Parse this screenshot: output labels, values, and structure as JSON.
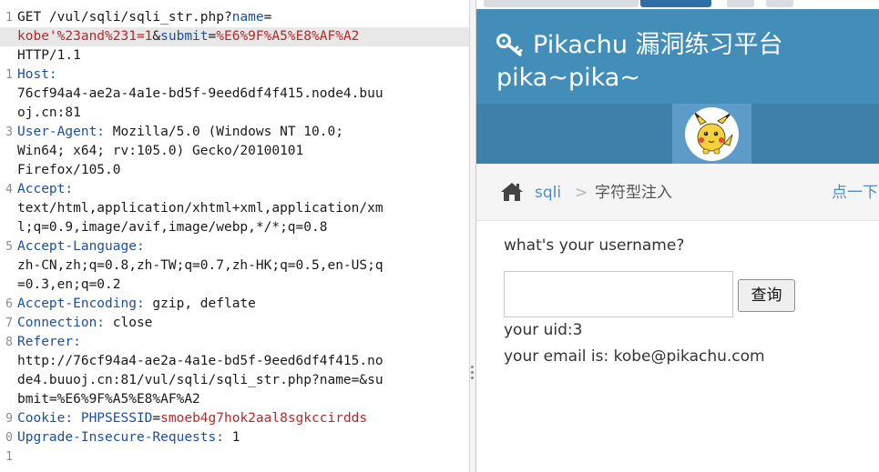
{
  "request_editor": {
    "lines": [
      {
        "num": "1",
        "highlight": false,
        "segments": [
          {
            "t": "GET /vul/sqli/sqli_str.php?",
            "c": ""
          },
          {
            "t": "name",
            "c": "pn"
          },
          {
            "t": "=",
            "c": ""
          }
        ]
      },
      {
        "num": "",
        "highlight": true,
        "segments": [
          {
            "t": "kobe'%23and%231=1",
            "c": "pv"
          },
          {
            "t": "&",
            "c": ""
          },
          {
            "t": "submit",
            "c": "pn"
          },
          {
            "t": "=",
            "c": ""
          },
          {
            "t": "%E6%9F%A5%E8%AF%A2",
            "c": "pv"
          }
        ]
      },
      {
        "num": "",
        "highlight": false,
        "segments": [
          {
            "t": "HTTP/1.1",
            "c": ""
          }
        ]
      },
      {
        "num": "1",
        "highlight": false,
        "segments": [
          {
            "t": "Host:",
            "c": "k"
          }
        ]
      },
      {
        "num": "",
        "highlight": false,
        "segments": [
          {
            "t": "76cf94a4-ae2a-4a1e-bd5f-9eed6df4f415.node4.buu",
            "c": ""
          }
        ]
      },
      {
        "num": "",
        "highlight": false,
        "segments": [
          {
            "t": "oj.cn:81",
            "c": ""
          }
        ]
      },
      {
        "num": "3",
        "highlight": false,
        "segments": [
          {
            "t": "User-Agent:",
            "c": "k"
          },
          {
            "t": " Mozilla/5.0 (Windows NT 10.0;",
            "c": ""
          }
        ]
      },
      {
        "num": "",
        "highlight": false,
        "segments": [
          {
            "t": "Win64; x64; rv:105.0) Gecko/20100101",
            "c": ""
          }
        ]
      },
      {
        "num": "",
        "highlight": false,
        "segments": [
          {
            "t": "Firefox/105.0",
            "c": ""
          }
        ]
      },
      {
        "num": "4",
        "highlight": false,
        "segments": [
          {
            "t": "Accept:",
            "c": "k"
          }
        ]
      },
      {
        "num": "",
        "highlight": false,
        "segments": [
          {
            "t": "text/html,application/xhtml+xml,application/xm",
            "c": ""
          }
        ]
      },
      {
        "num": "",
        "highlight": false,
        "segments": [
          {
            "t": "l;q=0.9,image/avif,image/webp,*/*;q=0.8",
            "c": ""
          }
        ]
      },
      {
        "num": "5",
        "highlight": false,
        "segments": [
          {
            "t": "Accept-Language:",
            "c": "k"
          }
        ]
      },
      {
        "num": "",
        "highlight": false,
        "segments": [
          {
            "t": "zh-CN,zh;q=0.8,zh-TW;q=0.7,zh-HK;q=0.5,en-US;q",
            "c": ""
          }
        ]
      },
      {
        "num": "",
        "highlight": false,
        "segments": [
          {
            "t": "=0.3,en;q=0.2",
            "c": ""
          }
        ]
      },
      {
        "num": "6",
        "highlight": false,
        "segments": [
          {
            "t": "Accept-Encoding:",
            "c": "k"
          },
          {
            "t": " gzip, deflate",
            "c": ""
          }
        ]
      },
      {
        "num": "7",
        "highlight": false,
        "segments": [
          {
            "t": "Connection:",
            "c": "k"
          },
          {
            "t": " close",
            "c": ""
          }
        ]
      },
      {
        "num": "8",
        "highlight": false,
        "segments": [
          {
            "t": "Referer:",
            "c": "k"
          }
        ]
      },
      {
        "num": "",
        "highlight": false,
        "segments": [
          {
            "t": "http://76cf94a4-ae2a-4a1e-bd5f-9eed6df4f415.no",
            "c": ""
          }
        ]
      },
      {
        "num": "",
        "highlight": false,
        "segments": [
          {
            "t": "de4.buuoj.cn:81/vul/sqli/sqli_str.php?name=&su",
            "c": ""
          }
        ]
      },
      {
        "num": "",
        "highlight": false,
        "segments": [
          {
            "t": "bmit=%E6%9F%A5%E8%AF%A2",
            "c": ""
          }
        ]
      },
      {
        "num": "9",
        "highlight": false,
        "segments": [
          {
            "t": "Cookie:",
            "c": "k"
          },
          {
            "t": " ",
            "c": ""
          },
          {
            "t": "PHPSESSID",
            "c": "pn"
          },
          {
            "t": "=",
            "c": ""
          },
          {
            "t": "smoeb4g7hok2aal8sgkccirdds",
            "c": "pv"
          }
        ]
      },
      {
        "num": "0",
        "highlight": false,
        "segments": [
          {
            "t": "Upgrade-Insecure-Requests:",
            "c": "k"
          },
          {
            "t": " 1",
            "c": ""
          }
        ]
      },
      {
        "num": "1",
        "highlight": false,
        "segments": []
      }
    ]
  },
  "browser": {
    "header": {
      "title": "Pikachu 漏洞练习平台",
      "subtitle": "pika~pika~"
    },
    "breadcrumb": {
      "section": "sqli",
      "separator": ">",
      "current": "字符型注入",
      "hint": "点一下"
    },
    "form": {
      "prompt": "what's your username?",
      "input_value": "",
      "button_label": "查询"
    },
    "result": {
      "uid": "your uid:3",
      "email": "your email is: kobe@pikachu.com"
    }
  },
  "colors": {
    "header_bg": "#438eb9",
    "nav_bg": "#3f80a8",
    "link": "#4c8fbd",
    "param_name": "#1c4fa0",
    "param_value": "#b42a2a"
  },
  "icons": {
    "brand": "key-icon",
    "home": "home-icon",
    "avatar": "pikachu-avatar"
  }
}
